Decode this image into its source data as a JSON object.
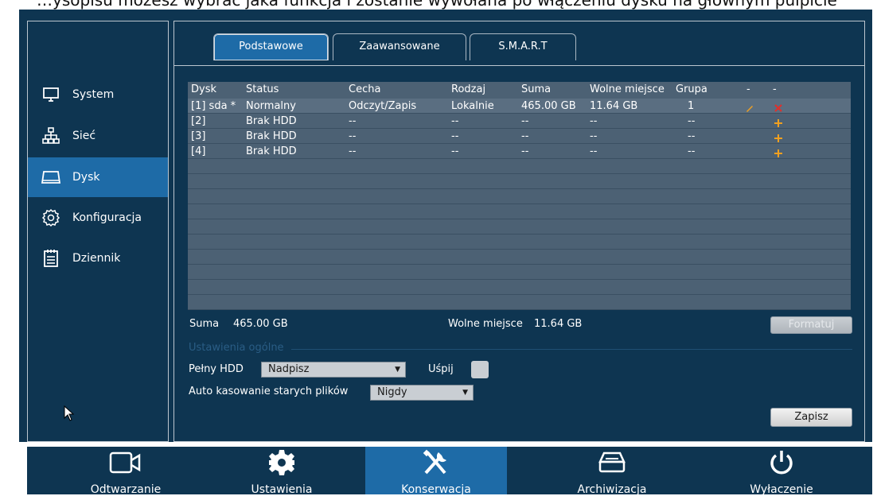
{
  "top_text": "…ysopisu możesz wybrać jaka funkcja i zostanie wywołana po włączeniu dysku na głownym pulpicie",
  "tabs": [
    {
      "label": "Podstawowe"
    },
    {
      "label": "Zaawansowane"
    },
    {
      "label": "S.M.A.R.T"
    }
  ],
  "sidebar": {
    "items": [
      {
        "label": "System",
        "icon": "monitor-icon"
      },
      {
        "label": "Sieć",
        "icon": "network-icon"
      },
      {
        "label": "Dysk",
        "icon": "hdd-icon"
      },
      {
        "label": "Konfiguracja",
        "icon": "gear-icon"
      },
      {
        "label": "Dziennik",
        "icon": "log-icon"
      }
    ]
  },
  "table": {
    "headers": [
      "Dysk",
      "Status",
      "Cecha",
      "Rodzaj",
      "Suma",
      "Wolne miejsce",
      "Grupa",
      "-",
      "-"
    ],
    "rows": [
      {
        "disk": "[1] sda *",
        "status": "Normalny",
        "feature": "Odczyt/Zapis",
        "type": "Lokalnie",
        "total": "465.00 GB",
        "free": "11.64 GB",
        "group": "1"
      },
      {
        "disk": "[2]",
        "status": "Brak HDD",
        "feature": "--",
        "type": "--",
        "total": "--",
        "free": "--",
        "group": "--"
      },
      {
        "disk": "[3]",
        "status": "Brak HDD",
        "feature": "--",
        "type": "--",
        "total": "--",
        "free": "--",
        "group": "--"
      },
      {
        "disk": "[4]",
        "status": "Brak HDD",
        "feature": "--",
        "type": "--",
        "total": "--",
        "free": "--",
        "group": "--"
      }
    ]
  },
  "summary": {
    "total_label": "Suma",
    "total_value": "465.00 GB",
    "free_label": "Wolne miejsce",
    "free_value": "11.64 GB",
    "format_button": "Formatuj"
  },
  "general": {
    "section_title": "Ustawienia ogólne",
    "full_hdd_label": "Pełny HDD",
    "full_hdd_value": "Nadpisz",
    "sleep_label": "Uśpij",
    "auto_delete_label": "Auto kasowanie starych plików",
    "auto_delete_value": "Nigdy",
    "save_button": "Zapisz"
  },
  "bottom_bar": [
    {
      "label": "Odtwarzanie",
      "icon": "camera-icon"
    },
    {
      "label": "Ustawienia",
      "icon": "settings-gear-icon"
    },
    {
      "label": "Konserwacja",
      "icon": "tools-icon"
    },
    {
      "label": "Archiwizacja",
      "icon": "archive-icon"
    },
    {
      "label": "Wyłaczenie",
      "icon": "power-icon"
    }
  ],
  "colors": {
    "background": "#0e3551",
    "active": "#1e6ba7",
    "table": "#4c6174",
    "edit_icon": "#f0a020",
    "delete_icon": "#e0302a",
    "add_icon": "#f0a020"
  }
}
